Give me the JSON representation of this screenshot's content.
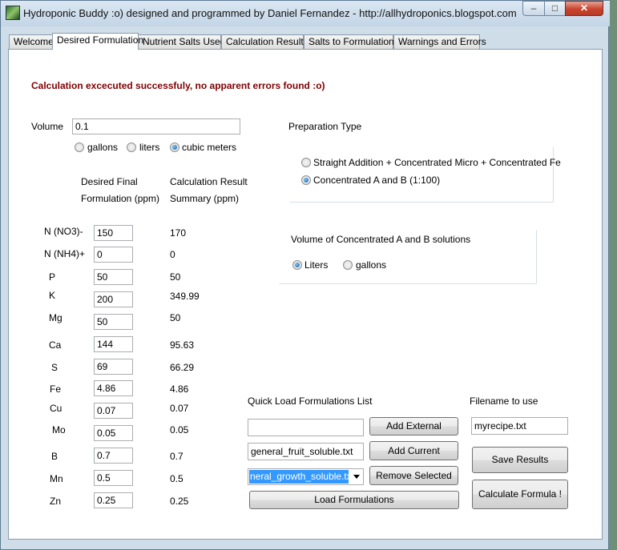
{
  "window": {
    "title": "Hydroponic Buddy :o) designed and programmed by Daniel Fernandez - http://allhydroponics.blogspot.com",
    "controls": {
      "minimize": "–",
      "maximize": "□",
      "close": "✕"
    }
  },
  "tabs": [
    "Welcome",
    "Desired Formulation",
    "Nutrient Salts Used",
    "Calculation Results",
    "Salts to Formulations",
    "Warnings and Errors"
  ],
  "active_tab": "Desired Formulation",
  "status_message": "Calculation excecuted successfuly, no apparent errors found :o)",
  "volume": {
    "label": "Volume",
    "value": "0.1",
    "units": [
      "gallons",
      "liters",
      "cubic meters"
    ],
    "selected_unit": "cubic meters"
  },
  "headers": {
    "desired_line1": "Desired Final",
    "desired_line2": "Formulation (ppm)",
    "result_line1": "Calculation Result",
    "result_line2": "Summary (ppm)"
  },
  "nutrients": [
    {
      "name": "N (NO3)-",
      "desired": "150",
      "result": "170"
    },
    {
      "name": "N (NH4)+",
      "desired": "0",
      "result": "0"
    },
    {
      "name": "P",
      "desired": "50",
      "result": "50"
    },
    {
      "name": "K",
      "desired": "200",
      "result": "349.99"
    },
    {
      "name": "Mg",
      "desired": "50",
      "result": "50"
    },
    {
      "name": "Ca",
      "desired": "144",
      "result": "95.63"
    },
    {
      "name": "S",
      "desired": "69",
      "result": "66.29"
    },
    {
      "name": "Fe",
      "desired": "4.86",
      "result": "4.86"
    },
    {
      "name": "Cu",
      "desired": "0.07",
      "result": "0.07"
    },
    {
      "name": "Mo",
      "desired": "0.05",
      "result": "0.05"
    },
    {
      "name": "B",
      "desired": "0.7",
      "result": "0.7"
    },
    {
      "name": "Mn",
      "desired": "0.5",
      "result": "0.5"
    },
    {
      "name": "Zn",
      "desired": "0.25",
      "result": "0.25"
    }
  ],
  "preparation": {
    "label": "Preparation Type",
    "options": [
      "Straight Addition + Concentrated Micro + Concentrated Fe",
      "Concentrated A and B (1:100)"
    ],
    "selected": "Concentrated A and B (1:100)"
  },
  "concentrate_volume": {
    "label": "Volume of Concentrated A and B solutions",
    "options": [
      "Liters",
      "gallons"
    ],
    "selected": "Liters"
  },
  "quick_load": {
    "label": "Quick Load Formulations List",
    "external_value": "",
    "current_value": "general_fruit_soluble.txt",
    "selected_value": "neral_growth_soluble.txt",
    "add_external": "Add External",
    "add_current": "Add Current",
    "remove_selected": "Remove Selected",
    "load": "Load Formulations"
  },
  "filename": {
    "label": "Filename to use",
    "value": "myrecipe.txt",
    "save": "Save Results",
    "calculate": "Calculate Formula !"
  }
}
